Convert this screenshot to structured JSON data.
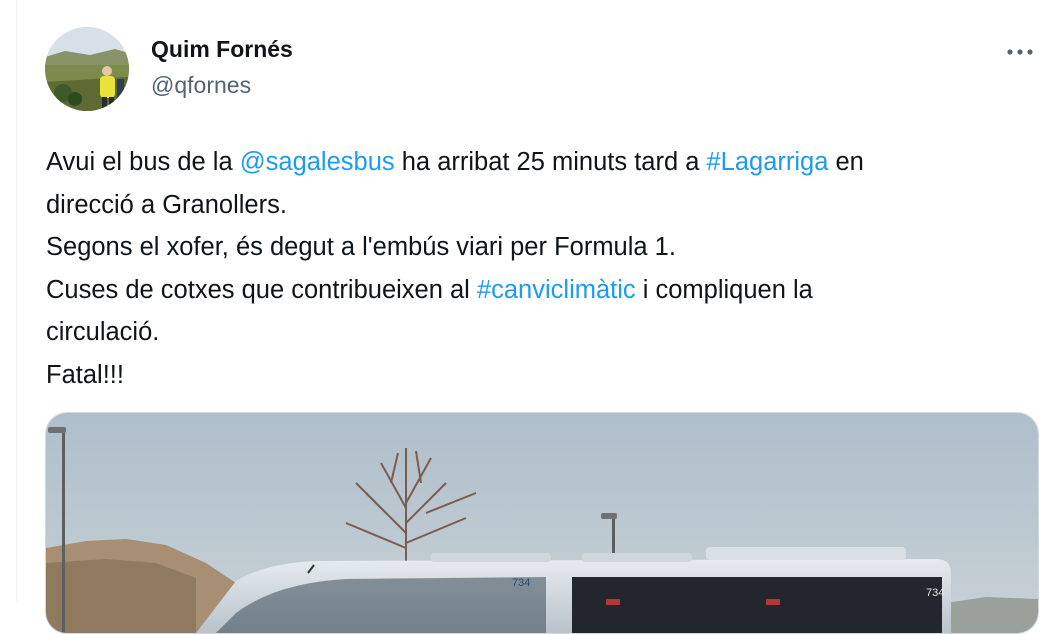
{
  "author": {
    "name": "Quim Fornés",
    "handle": "@qfornes"
  },
  "tweet": {
    "line1_a": "Avui el bus de la ",
    "line1_mention": "@sagalesbus",
    "line1_b": " ha arribat 25 minuts tard a ",
    "line1_hashtag": "#Lagarriga",
    "line1_c": " en",
    "line2": "direcció a Granollers.",
    "line3": "Segons el xofer, és degut a l'embús viari per Formula 1.",
    "line4_a": "Cuses de cotxes que contribueixen al ",
    "line4_hashtag": "#canviclimàtic",
    "line4_b": " i compliquen la",
    "line5": "circulació.",
    "line6": "Fatal!!!"
  },
  "media": {
    "bus_number_front": "734",
    "bus_number_side": "734"
  },
  "icons": {
    "more": "more-horizontal-icon"
  },
  "colors": {
    "link": "#1d9bf0",
    "text": "#0f1419",
    "secondary": "#536471"
  }
}
